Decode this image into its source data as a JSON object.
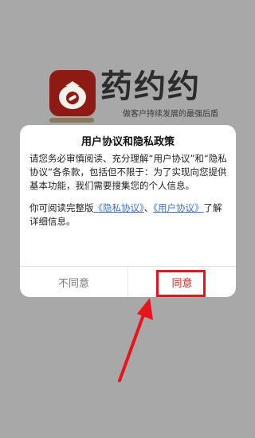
{
  "splash": {
    "app_name": "药约约",
    "slogan": "做客户持续发展的最强后盾"
  },
  "dialog": {
    "title": "用户协议和隐私政策",
    "para1": "请您务必审慎阅读、充分理解“用户协议”和“隐私协议”各条款，包括但不限于：为了实现向您提供基本功能，我们需要搜集您的个人信息。",
    "para2_prefix": "你可阅读完整版",
    "privacy_link": "《隐私协议》",
    "para2_sep": "、",
    "user_link": "《用户协议》",
    "para2_suffix": "了解详细信息。",
    "disagree_label": "不同意",
    "agree_label": "同意"
  },
  "colors": {
    "agree": "#dd2222",
    "link": "#3b6fd6",
    "annotation": "#e8131b"
  }
}
